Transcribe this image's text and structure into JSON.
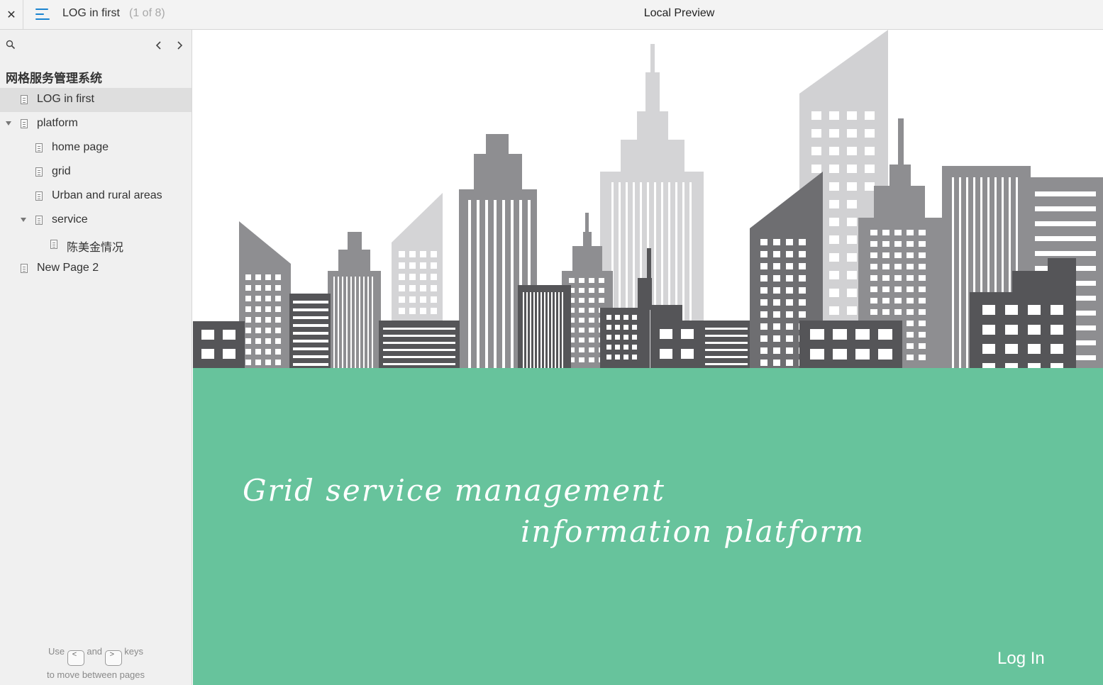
{
  "topbar": {
    "close_icon": "close-icon",
    "menu_icon": "menu-icon",
    "page_title": "LOG in first",
    "page_count": "(1 of 8)",
    "preview_label": "Local Preview"
  },
  "sidebar": {
    "project_title": "网格服务管理系统",
    "items": [
      {
        "label": "LOG in first",
        "selected": true
      },
      {
        "label": "platform",
        "expanded": true
      },
      {
        "label": "home page"
      },
      {
        "label": "grid"
      },
      {
        "label": "Urban and rural areas"
      },
      {
        "label": "service",
        "expanded": true
      },
      {
        "label": "陈美金情况"
      },
      {
        "label": "New Page 2"
      }
    ],
    "hint": {
      "use": "Use",
      "and": "and",
      "keys": "keys",
      "line2": "to move between pages",
      "prev_key": "<",
      "next_key": ">"
    }
  },
  "main": {
    "headline_line1": "Grid service management",
    "headline_line2": "information platform",
    "login_label": "Log In",
    "banner_color": "#67c39c"
  },
  "colors": {
    "accent": "#1a84d0",
    "banner": "#67c39c",
    "building_dark": "#555558",
    "building_mid": "#8e8e91",
    "building_light": "#d1d1d3"
  }
}
